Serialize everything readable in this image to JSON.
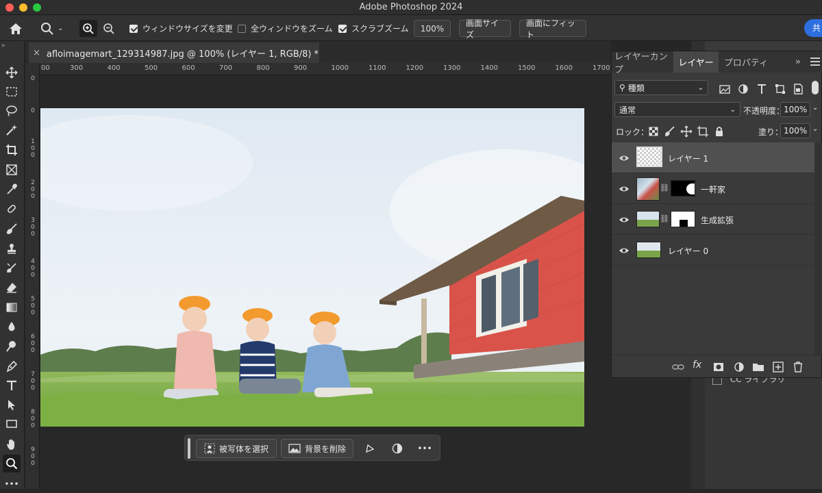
{
  "titlebar": {
    "app_title": "Adobe Photoshop 2024"
  },
  "options": {
    "zoom_in": "zoom-in",
    "zoom_out": "zoom-out",
    "resize_windows_label": "ウィンドウサイズを変更",
    "resize_windows_checked": true,
    "zoom_all_label": "全ウィンドウをズーム",
    "zoom_all_checked": false,
    "scrubby_label": "スクラブズーム",
    "scrubby_checked": true,
    "zoom_value": "100%",
    "fit_screen_label": "画面サイズ",
    "fill_screen_label": "画面にフィット",
    "share_label": "共"
  },
  "document": {
    "tab_title": "afloimagemart_129314987.jpg @ 100% (レイヤー 1, RGB/8) *",
    "close_glyph": "×"
  },
  "ruler": {
    "h_ticks": [
      "00",
      "300",
      "400",
      "500",
      "600",
      "700",
      "800",
      "900",
      "1000",
      "1100",
      "1200",
      "1300",
      "1400",
      "1500",
      "1600",
      "1700"
    ],
    "v_ticks": [
      "0",
      "0",
      "1\n0\n0",
      "2\n0\n0",
      "3\n0\n0",
      "4\n0\n0",
      "5\n0\n0",
      "6\n0\n0",
      "7\n0\n0",
      "8\n0\n0",
      "9\n0\n0"
    ]
  },
  "contextual_bar": {
    "select_subject": "被写体を選択",
    "remove_background": "背景を削除",
    "more": "•••"
  },
  "layers_panel": {
    "tabs": [
      {
        "label": "レイヤーカンプ",
        "active": false
      },
      {
        "label": "レイヤー",
        "active": true
      },
      {
        "label": "プロパティ",
        "active": false
      }
    ],
    "collapse_glyph": "»",
    "filter_kind": "種類",
    "blend_mode": "通常",
    "opacity_label": "不透明度：",
    "opacity_value": "100%",
    "lock_label": "ロック：",
    "fill_label": "塗り：",
    "fill_value": "100%",
    "layers": [
      {
        "name": "レイヤー 1",
        "selected": true,
        "visible": true
      },
      {
        "name": "一軒家",
        "selected": false,
        "visible": true
      },
      {
        "name": "生成拡張",
        "selected": false,
        "visible": true
      },
      {
        "name": "レイヤー 0",
        "selected": false,
        "visible": true
      }
    ]
  },
  "side_panel": {
    "cc_libraries": "CC ライブラリ"
  },
  "colors": {
    "accent": "#2d6fe0",
    "house_red": "#d9534a",
    "sky": "#e4ecf3",
    "grass": "#7fb24a"
  }
}
